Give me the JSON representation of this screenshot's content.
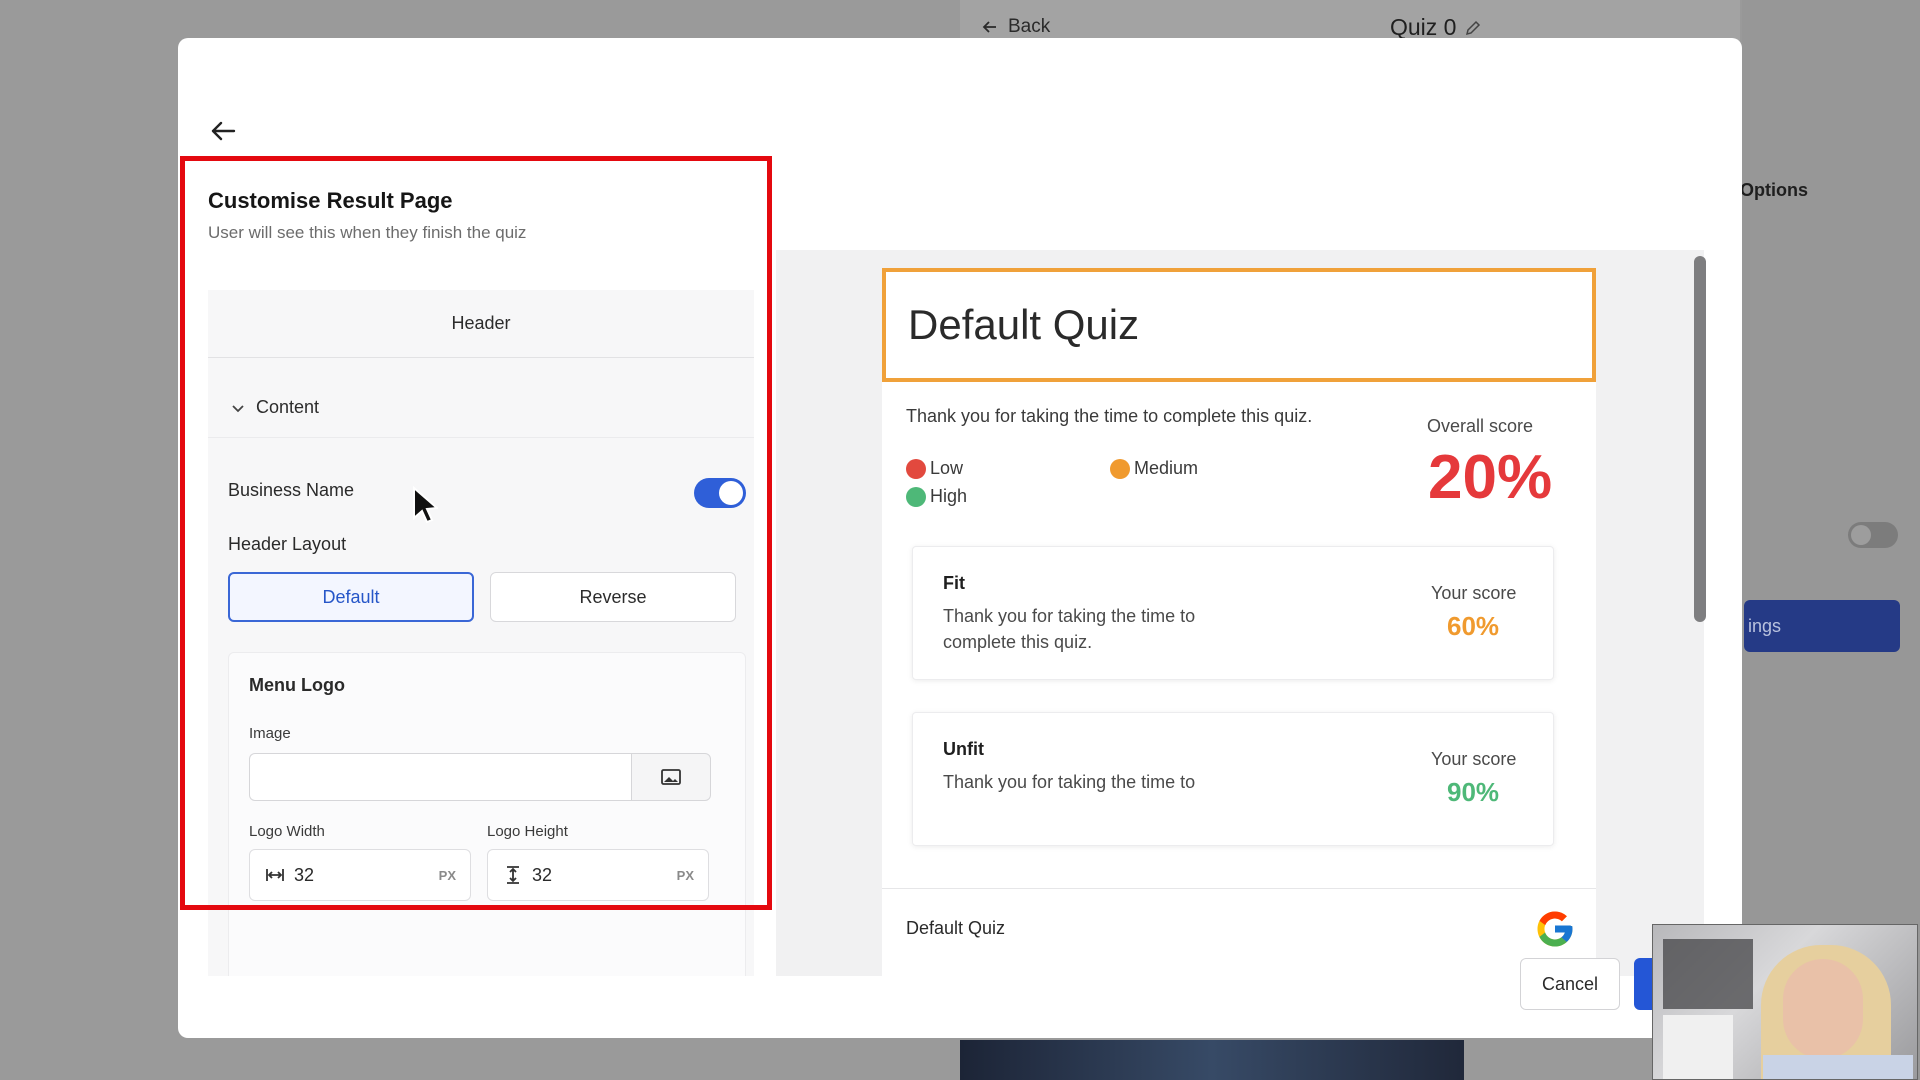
{
  "background": {
    "back_label": "Back",
    "quiz_title": "Quiz 0",
    "options_label": "Options",
    "button_label": "ings"
  },
  "modal": {
    "title": "Customise Result Page",
    "subtitle": "User will see this when they finish the quiz",
    "settings": {
      "header_tab": "Header",
      "content_section": "Content",
      "business_name_label": "Business Name",
      "business_name_enabled": true,
      "header_layout_label": "Header Layout",
      "layout_options": [
        "Default",
        "Reverse"
      ],
      "layout_selected": "Default",
      "menu_logo": {
        "title": "Menu Logo",
        "image_label": "Image",
        "image_value": "",
        "width_label": "Logo Width",
        "width_value": "32",
        "height_label": "Logo Height",
        "height_value": "32",
        "unit": "PX"
      }
    },
    "preview": {
      "quiz_name": "Default Quiz",
      "thanks_text": "Thank you for taking the time to complete this quiz.",
      "legend": [
        {
          "label": "Low",
          "color": "#e2493e"
        },
        {
          "label": "Medium",
          "color": "#f09a2e"
        },
        {
          "label": "High",
          "color": "#4eb878"
        }
      ],
      "overall_label": "Overall score",
      "overall_value": "20%",
      "overall_color": "#e5393b",
      "results": [
        {
          "name": "Fit",
          "description": "Thank you for taking the time to complete this quiz.",
          "score_label": "Your score",
          "score": "60%",
          "score_color": "#f09a2e"
        },
        {
          "name": "Unfit",
          "description": "Thank you for taking the time to",
          "score_label": "Your score",
          "score": "90%",
          "score_color": "#4eb878"
        }
      ],
      "footer_name": "Default Quiz",
      "footer_icon": "google-icon"
    },
    "cancel_label": "Cancel"
  }
}
